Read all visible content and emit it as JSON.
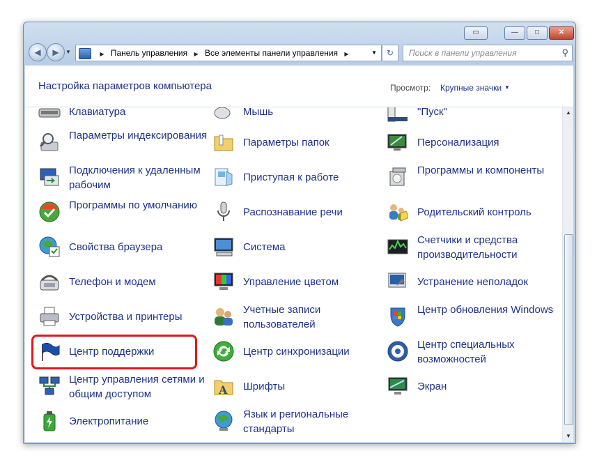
{
  "titlebar": {
    "extra_button": "▭",
    "minimize_button": "—",
    "maximize_button": "□",
    "close_button": "✕"
  },
  "address": {
    "breadcrumb": [
      "Панель управления",
      "Все элементы панели управления"
    ],
    "separator": "▶",
    "dropdown": "▼",
    "refresh": "↻"
  },
  "search": {
    "placeholder": "Поиск в панели управления",
    "icon": "⚲"
  },
  "header": {
    "title": "Настройка параметров компьютера",
    "view_label": "Просмотр:",
    "view_value": "Крупные значки",
    "view_arrow": "▼"
  },
  "items": [
    {
      "label": "Клавиатура",
      "icon": "keyboard-icon"
    },
    {
      "label": "Мышь",
      "icon": "mouse-icon"
    },
    {
      "label": "\"Пуск\"",
      "icon": "taskbar-icon"
    },
    {
      "label": "Параметры индексирования",
      "icon": "indexing-icon"
    },
    {
      "label": "Параметры папок",
      "icon": "folder-options-icon"
    },
    {
      "label": "Персонализация",
      "icon": "personalization-icon"
    },
    {
      "label": "Подключения к удаленным рабочим",
      "icon": "remote-desktop-icon"
    },
    {
      "label": "Приступая к работе",
      "icon": "getting-started-icon"
    },
    {
      "label": "Программы и компоненты",
      "icon": "programs-icon"
    },
    {
      "label": "Программы по умолчанию",
      "icon": "default-programs-icon"
    },
    {
      "label": "Распознавание речи",
      "icon": "microphone-icon"
    },
    {
      "label": "Родительский контроль",
      "icon": "parental-controls-icon"
    },
    {
      "label": "Свойства браузера",
      "icon": "internet-options-icon"
    },
    {
      "label": "Система",
      "icon": "system-icon"
    },
    {
      "label": "Счетчики и средства производительности",
      "icon": "performance-icon"
    },
    {
      "label": "Телефон и модем",
      "icon": "phone-modem-icon"
    },
    {
      "label": "Управление цветом",
      "icon": "color-management-icon"
    },
    {
      "label": "Устранение неполадок",
      "icon": "troubleshooting-icon"
    },
    {
      "label": "Устройства и принтеры",
      "icon": "printer-icon"
    },
    {
      "label": "Учетные записи пользователей",
      "icon": "user-accounts-icon"
    },
    {
      "label": "Центр обновления Windows",
      "icon": "windows-update-icon"
    },
    {
      "label": "Центр поддержки",
      "icon": "action-center-flag-icon"
    },
    {
      "label": "Центр синхронизации",
      "icon": "sync-center-icon"
    },
    {
      "label": "Центр специальных возможностей",
      "icon": "ease-of-access-icon"
    },
    {
      "label": "Центр управления сетями и общим доступом",
      "icon": "network-center-icon"
    },
    {
      "label": "Шрифты",
      "icon": "fonts-icon"
    },
    {
      "label": "Экран",
      "icon": "display-icon"
    },
    {
      "label": "Электропитание",
      "icon": "power-options-icon"
    },
    {
      "label": "Язык и региональные стандарты",
      "icon": "region-language-icon"
    }
  ],
  "scrollbar": {
    "up": "▲",
    "down": "▼"
  },
  "colors": {
    "link": "#1e3287",
    "highlight": "#e0161b"
  }
}
